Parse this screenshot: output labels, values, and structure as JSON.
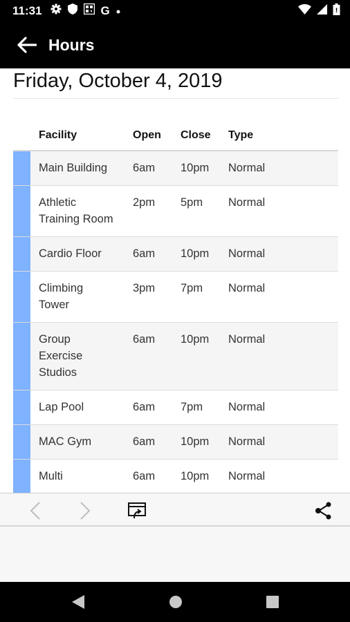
{
  "status_bar": {
    "time": "11:31",
    "icons": [
      "gear-icon",
      "shield-icon",
      "qr-icon",
      "g-icon",
      "dot-icon",
      "wifi-icon",
      "signal-icon",
      "battery-icon"
    ],
    "g_glyph": "G"
  },
  "app_bar": {
    "title": "Hours"
  },
  "page": {
    "date": "Friday, October 4, 2019"
  },
  "table": {
    "headers": {
      "facility": "Facility",
      "open": "Open",
      "close": "Close",
      "type": "Type"
    },
    "rows": [
      {
        "facility": "Main Building",
        "open": "6am",
        "close": "10pm",
        "type": "Normal"
      },
      {
        "facility": "Athletic Training Room",
        "open": "2pm",
        "close": "5pm",
        "type": "Normal"
      },
      {
        "facility": "Cardio Floor",
        "open": "6am",
        "close": "10pm",
        "type": "Normal"
      },
      {
        "facility": "Climbing Tower",
        "open": "3pm",
        "close": "7pm",
        "type": "Normal"
      },
      {
        "facility": "Group Exercise Studios",
        "open": "6am",
        "close": "10pm",
        "type": "Normal"
      },
      {
        "facility": "Lap Pool",
        "open": "6am",
        "close": "7pm",
        "type": "Normal"
      },
      {
        "facility": "MAC Gym",
        "open": "6am",
        "close": "10pm",
        "type": "Normal"
      },
      {
        "facility": "Multi",
        "open": "6am",
        "close": "10pm",
        "type": "Normal"
      }
    ]
  },
  "colors": {
    "accent_bar": "#7fb2ff",
    "link": "#1f6fd1",
    "app_bar_bg": "#000000"
  }
}
